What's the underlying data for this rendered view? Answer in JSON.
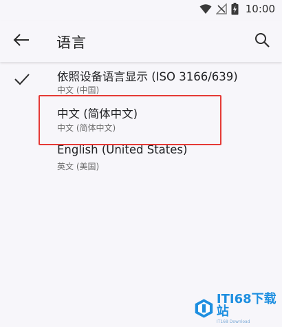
{
  "status_bar": {
    "time": "10:00",
    "icons": [
      "wifi-icon",
      "no-signal-icon",
      "battery-charging-icon"
    ]
  },
  "app_bar": {
    "back_icon": "arrow-back-icon",
    "title": "语言",
    "search_icon": "search-icon"
  },
  "languages": [
    {
      "title": "依照设备语言显示 (ISO 3166/639)",
      "subtitle": "中文 (中国)",
      "selected": true
    },
    {
      "title": "中文 (简体中文)",
      "subtitle": "中文 (简体中文)",
      "selected": false
    },
    {
      "title": "English (United States)",
      "subtitle": "英文 (美国)",
      "selected": false
    }
  ],
  "colors": {
    "background": "#f7f6fa",
    "highlight": "#e53935",
    "watermark": "#1e8fe0"
  },
  "watermark": {
    "text": "ITI68下载站",
    "subtext": "IT168 Download"
  }
}
